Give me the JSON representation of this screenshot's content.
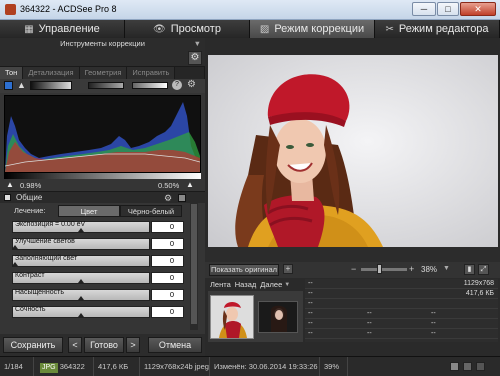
{
  "window": {
    "title": "364322 - ACDSee Pro 8",
    "minimize": "─",
    "maximize": "□",
    "close": "✕"
  },
  "tabs": [
    {
      "label": "Управление",
      "icon": "grid-icon",
      "active": false
    },
    {
      "label": "Просмотр",
      "icon": "eye-icon",
      "active": false
    },
    {
      "label": "Режим коррекции",
      "icon": "image-icon",
      "active": true
    },
    {
      "label": "Режим редактора",
      "icon": "tools-icon",
      "active": false
    }
  ],
  "left_panel": {
    "title": "Инструменты коррекции",
    "subtabs": [
      "Тон",
      "Детализация",
      "Геометрия",
      "Исправить"
    ],
    "clip_left": "0.98%",
    "clip_right": "0.50%",
    "section_title": "Общие",
    "mode_label": "Лечение:",
    "mode_options": [
      "Цвет",
      "Чёрно-белый"
    ],
    "mode_selected": "Цвет",
    "sliders": [
      {
        "label": "Экспозиция = 0.00 eV",
        "value": "0",
        "thumb": 0.5
      },
      {
        "label": "Улучшение светов",
        "value": "0",
        "thumb": 0.0
      },
      {
        "label": "Заполняющий свет",
        "value": "0",
        "thumb": 0.0
      },
      {
        "label": "Контраст",
        "value": "0",
        "thumb": 0.5
      },
      {
        "label": "Насыщенность",
        "value": "0",
        "thumb": 0.5
      },
      {
        "label": "Сочность",
        "value": "0",
        "thumb": 0.5
      }
    ],
    "buttons": {
      "save": "Сохранить",
      "prev": "<",
      "done": "Готово",
      "next": ">",
      "cancel": "Отмена"
    }
  },
  "viewer": {
    "show_original": "Показать оригинал",
    "zoom": "38%"
  },
  "filmstrip": {
    "tabs": [
      "Лента",
      "Назад",
      "Далее"
    ]
  },
  "info": {
    "rows": [
      {
        "left": "--",
        "right": "1129x768"
      },
      {
        "left": "--",
        "right": "417,6 КБ"
      },
      {
        "left": "--",
        "right": ""
      },
      {
        "left": "--",
        "right": "--"
      },
      {
        "left": "--",
        "right": "--"
      },
      {
        "left": "--",
        "right": "--"
      }
    ]
  },
  "status": {
    "index": "1/184",
    "format": "JPG",
    "filename": "364322",
    "size": "417,6 КБ",
    "dimensions": "1129x768x24b jpeg",
    "modified": "Изменён: 30.06.2014 19:33:26",
    "zoom": "39%"
  },
  "colors": {
    "accent_active_tab": "#5a5a5a",
    "background": "#2a2a2a",
    "viewer_bg": "#e6e6e6"
  }
}
